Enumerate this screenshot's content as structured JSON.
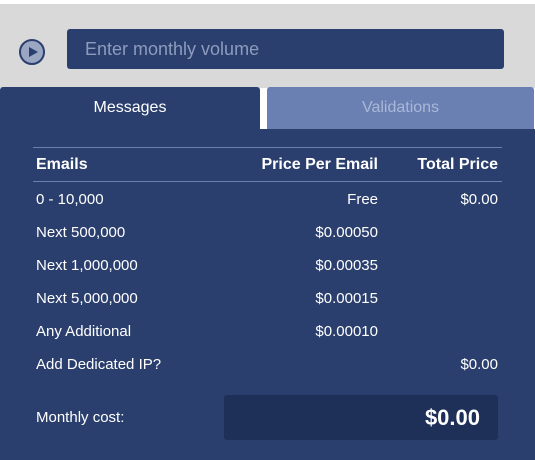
{
  "volume": {
    "placeholder": "Enter monthly volume"
  },
  "tabs": [
    {
      "label": "Messages",
      "active": true
    },
    {
      "label": "Validations",
      "active": false
    }
  ],
  "table": {
    "headers": {
      "emails": "Emails",
      "price_per_email": "Price Per Email",
      "total_price": "Total Price"
    },
    "rows": [
      {
        "label": "0  -  10,000",
        "price": "Free",
        "total": "$0.00"
      },
      {
        "label": "Next 500,000",
        "price": "$0.00050",
        "total": ""
      },
      {
        "label": "Next 1,000,000",
        "price": "$0.00035",
        "total": ""
      },
      {
        "label": "Next 5,000,000",
        "price": "$0.00015",
        "total": ""
      },
      {
        "label": "Any Additional",
        "price": "$0.00010",
        "total": ""
      },
      {
        "label": "Add Dedicated IP?",
        "price": "",
        "total": "$0.00"
      }
    ]
  },
  "monthly": {
    "label": "Monthly cost:",
    "value": "$0.00"
  },
  "colors": {
    "panel": "#2b3f6e",
    "tab_inactive": "#6a7fb2",
    "top_bar": "#d9d9d9",
    "cost_box": "#1e2f58"
  }
}
